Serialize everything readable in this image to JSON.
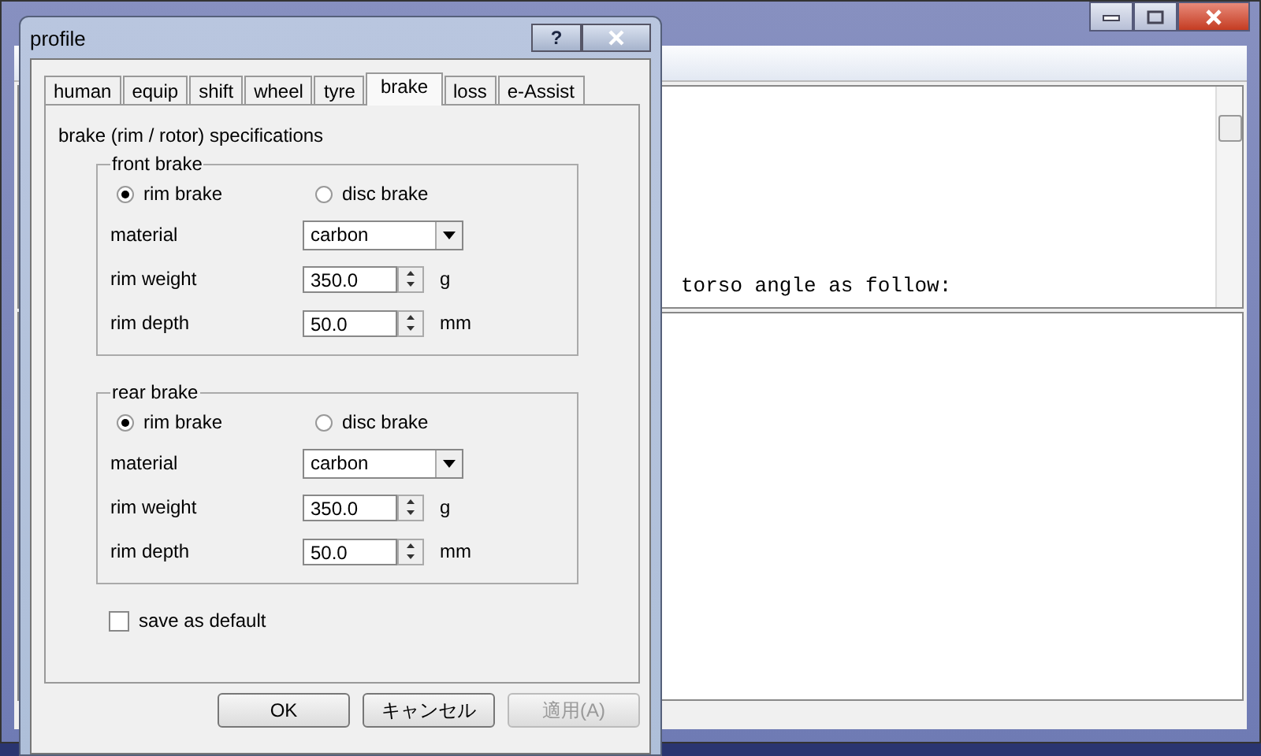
{
  "main_window": {
    "text_line": "torso angle as follow:"
  },
  "dialog": {
    "title": "profile",
    "help": "?",
    "tabs": [
      {
        "label": "human",
        "selected": false
      },
      {
        "label": "equip",
        "selected": false
      },
      {
        "label": "shift",
        "selected": false
      },
      {
        "label": "wheel",
        "selected": false
      },
      {
        "label": "tyre",
        "selected": false
      },
      {
        "label": "brake",
        "selected": true
      },
      {
        "label": "loss",
        "selected": false
      },
      {
        "label": "e-Assist",
        "selected": false
      }
    ],
    "heading": "brake (rim / rotor) specifications",
    "groups": [
      {
        "title": "front brake",
        "options": [
          {
            "label": "rim brake",
            "selected": true
          },
          {
            "label": "disc brake",
            "selected": false
          }
        ],
        "material_label": "material",
        "material_value": "carbon",
        "fields": [
          {
            "label": "rim weight",
            "value": "350.0",
            "unit": "g"
          },
          {
            "label": "rim depth",
            "value": "50.0",
            "unit": "mm"
          }
        ]
      },
      {
        "title": "rear brake",
        "options": [
          {
            "label": "rim brake",
            "selected": true
          },
          {
            "label": "disc brake",
            "selected": false
          }
        ],
        "material_label": "material",
        "material_value": "carbon",
        "fields": [
          {
            "label": "rim weight",
            "value": "350.0",
            "unit": "g"
          },
          {
            "label": "rim depth",
            "value": "50.0",
            "unit": "mm"
          }
        ]
      }
    ],
    "save_default": {
      "label": "save as default",
      "checked": false
    },
    "buttons": [
      {
        "label": "OK",
        "disabled": false
      },
      {
        "label": "キャンセル",
        "disabled": false
      },
      {
        "label": "適用(A)",
        "disabled": true
      }
    ]
  }
}
